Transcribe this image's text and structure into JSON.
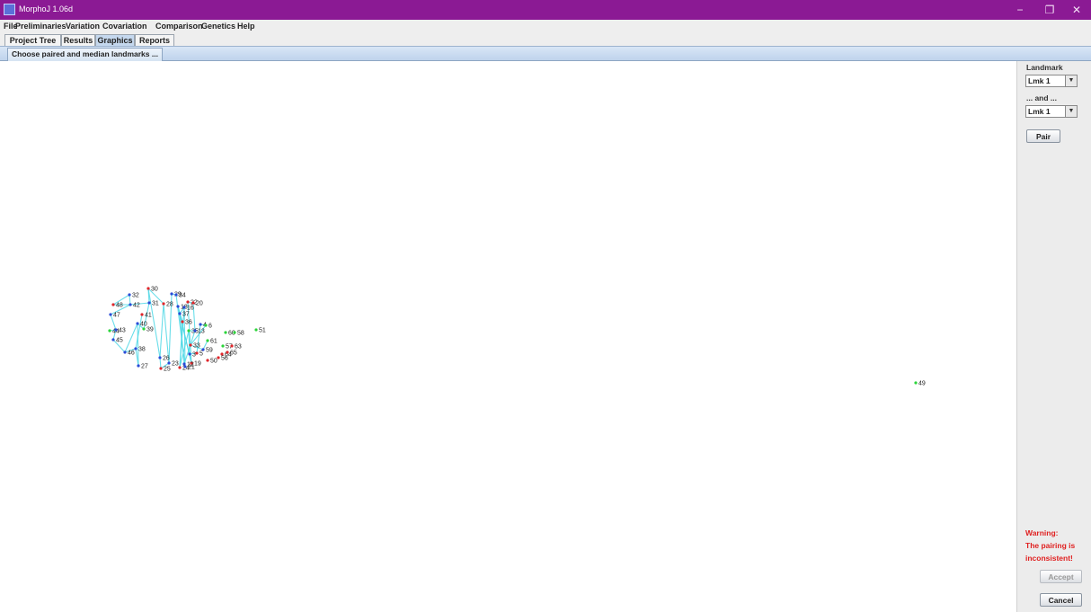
{
  "window": {
    "title": "MorphoJ 1.06d",
    "controls": [
      "−",
      "❐",
      "✕"
    ]
  },
  "menu": [
    "File",
    "Preliminaries",
    "Variation",
    "Covariation",
    "Comparison",
    "Genetics",
    "Help"
  ],
  "tabs": [
    "Project Tree",
    "Results",
    "Graphics",
    "Reports"
  ],
  "active_tab": "Graphics",
  "subtab": "Choose paired and median landmarks ...",
  "panel": {
    "landmark_label": "Landmark",
    "first_select": "Lmk 1",
    "and_label": "... and ...",
    "second_select": "Lmk 1",
    "pair_button": "Pair",
    "warning_title": "Warning:",
    "warning_line1": "The pairing is",
    "warning_line2": "inconsistent!",
    "accept_button": "Accept",
    "cancel_button": "Cancel"
  },
  "colors": {
    "titlebar": "#8b1a94",
    "link": "#4fd8e6",
    "blue": "#2a4bd7",
    "red": "#e0262b",
    "green": "#2bd43a",
    "warning": "#e02020"
  },
  "landmarks": [
    {
      "id": "30",
      "c": "red"
    },
    {
      "id": "32",
      "c": "blue"
    },
    {
      "id": "48",
      "c": "red"
    },
    {
      "id": "42",
      "c": "blue"
    },
    {
      "id": "31",
      "c": "blue"
    },
    {
      "id": "28",
      "c": "red"
    },
    {
      "id": "29",
      "c": "blue"
    },
    {
      "id": "34",
      "c": "blue"
    },
    {
      "id": "22",
      "c": "red"
    },
    {
      "id": "20",
      "c": "red"
    },
    {
      "id": "18",
      "c": "blue"
    },
    {
      "id": "16",
      "c": "blue"
    },
    {
      "id": "37",
      "c": "blue"
    },
    {
      "id": "47",
      "c": "blue"
    },
    {
      "id": "41",
      "c": "red"
    },
    {
      "id": "40",
      "c": "blue"
    },
    {
      "id": "39",
      "c": "green"
    },
    {
      "id": "36",
      "c": "red"
    },
    {
      "id": "44",
      "c": "green"
    },
    {
      "id": "43",
      "c": "blue"
    },
    {
      "id": "35",
      "c": "green"
    },
    {
      "id": "13",
      "c": "blue"
    },
    {
      "id": "4",
      "c": "blue"
    },
    {
      "id": "6",
      "c": "green"
    },
    {
      "id": "45",
      "c": "blue"
    },
    {
      "id": "60",
      "c": "green"
    },
    {
      "id": "58",
      "c": "green"
    },
    {
      "id": "51",
      "c": "green"
    },
    {
      "id": "61",
      "c": "green"
    },
    {
      "id": "57",
      "c": "green"
    },
    {
      "id": "63",
      "c": "red"
    },
    {
      "id": "33",
      "c": "red"
    },
    {
      "id": "59",
      "c": "blue"
    },
    {
      "id": "46",
      "c": "blue"
    },
    {
      "id": "38",
      "c": "blue"
    },
    {
      "id": "5",
      "c": "red"
    },
    {
      "id": "3",
      "c": "blue"
    },
    {
      "id": "64",
      "c": "red"
    },
    {
      "id": "65",
      "c": "red"
    },
    {
      "id": "26",
      "c": "blue"
    },
    {
      "id": "23",
      "c": "blue"
    },
    {
      "id": "50",
      "c": "red"
    },
    {
      "id": "56",
      "c": "red"
    },
    {
      "id": "19",
      "c": "red"
    },
    {
      "id": "12",
      "c": "blue"
    },
    {
      "id": "27",
      "c": "blue"
    },
    {
      "id": "25",
      "c": "red"
    },
    {
      "id": "24",
      "c": "red"
    },
    {
      "id": "21",
      "c": "blue"
    },
    {
      "id": "49",
      "c": "green"
    }
  ]
}
